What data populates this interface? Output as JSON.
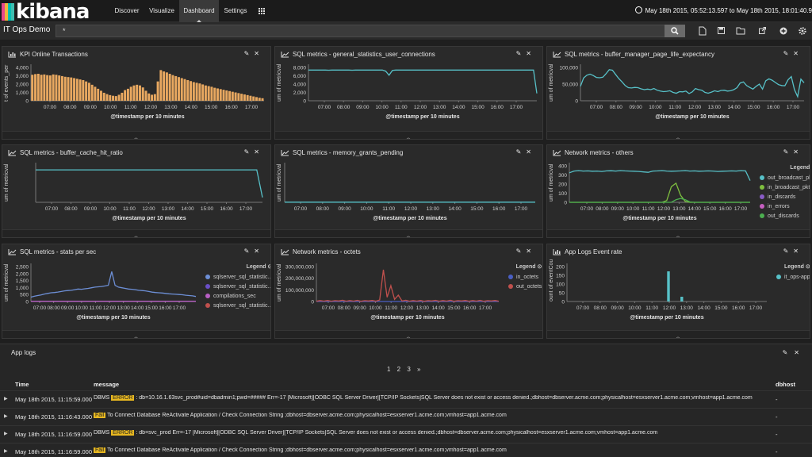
{
  "brand": {
    "logo_text": "kibana",
    "bar_colors": [
      "#e8478b",
      "#f0b73c",
      "#00bfb3",
      "#3ebeb0"
    ]
  },
  "nav": {
    "tabs": [
      "Discover",
      "Visualize",
      "Dashboard",
      "Settings"
    ],
    "active": "Dashboard",
    "more_icon": "apps-icon"
  },
  "timerange": {
    "text": "May 18th 2015, 05:52:13.597 to May 18th 2015, 18:01:40.9"
  },
  "dashboard": {
    "title": "IT Ops Demo",
    "query": "*"
  },
  "toolbar_icons": [
    "search-icon",
    "new-dashboard-icon",
    "save-icon",
    "open-icon",
    "share-icon",
    "add-panel-icon",
    "settings-icon"
  ],
  "panels": [
    {
      "id": "p1",
      "title": "KPI Online Transactions",
      "vis_icon": "bar-chart-icon",
      "ylabel": "t of events_per",
      "xlabel": "@timestamp per 10 minutes"
    },
    {
      "id": "p2",
      "title": "SQL metrics - general_statistics_user_connections",
      "vis_icon": "line-chart-icon",
      "ylabel": "um of metricval",
      "xlabel": "@timestamp per 10 minutes"
    },
    {
      "id": "p3",
      "title": "SQL metrics - buffer_manager_page_life_expectancy",
      "vis_icon": "line-chart-icon",
      "ylabel": "um of metricval",
      "xlabel": "@timestamp per 10 minutes"
    },
    {
      "id": "p4",
      "title": "SQL metrics - buffer_cache_hit_ratio",
      "vis_icon": "line-chart-icon",
      "ylabel": "um of metricval",
      "xlabel": "@timestamp per 10 minutes"
    },
    {
      "id": "p5",
      "title": "SQL metrics - memory_grants_pending",
      "vis_icon": "line-chart-icon",
      "ylabel": "um of metricval",
      "xlabel": "@timestamp per 10 minutes"
    },
    {
      "id": "p6",
      "title": "Network metrics - others",
      "vis_icon": "line-chart-icon",
      "ylabel": "um of metricval",
      "xlabel": "@timestamp per 10 minutes",
      "legend_title": "Legend",
      "legend": [
        {
          "label": "out_broadcast_pkts",
          "color": "#57c1c8"
        },
        {
          "label": "in_broadcast_pkts",
          "color": "#7fbf3f"
        },
        {
          "label": "in_discards",
          "color": "#8a5cc7"
        },
        {
          "label": "in_errors",
          "color": "#c55fc0"
        },
        {
          "label": "out_discards",
          "color": "#4caf50"
        }
      ]
    },
    {
      "id": "p7",
      "title": "SQL metrics - stats per sec",
      "vis_icon": "line-chart-icon",
      "ylabel": "um of metricval",
      "xlabel": "@timestamp per 10 minutes",
      "legend_title": "Legend",
      "legend": [
        {
          "label": "sqlserver_sql_statistic...",
          "color": "#6d8fd6"
        },
        {
          "label": "sqlserver_sql_statistic...",
          "color": "#6a4fc7"
        },
        {
          "label": "compilations_sec",
          "color": "#b85fc4"
        },
        {
          "label": "sqlserver_sql_statistic...",
          "color": "#c0504d"
        }
      ]
    },
    {
      "id": "p8",
      "title": "Network metrics - octets",
      "vis_icon": "line-chart-icon",
      "ylabel": "um of metricval",
      "xlabel": "@timestamp per 10 minutes",
      "legend_title": "Legend",
      "legend": [
        {
          "label": "in_octets",
          "color": "#4a5fc4"
        },
        {
          "label": "out_octets",
          "color": "#c0504d"
        }
      ]
    },
    {
      "id": "p9",
      "title": "App Logs Event rate",
      "vis_icon": "bar-chart-icon",
      "ylabel": "ount of eventCou",
      "xlabel": "@timestamp per 10 minutes",
      "legend_title": "Legend",
      "legend": [
        {
          "label": "it_ops-app",
          "color": "#57c1c8"
        }
      ]
    }
  ],
  "x_ticks": [
    "07:00",
    "08:00",
    "09:00",
    "10:00",
    "11:00",
    "12:00",
    "13:00",
    "14:00",
    "15:00",
    "16:00",
    "17:00"
  ],
  "p7_ticks": [
    "07:00",
    "08:00",
    "09:00",
    "10:00",
    "11:00",
    "12:00",
    "13:00",
    "14:00",
    "15:00",
    "16:00",
    "17:00"
  ],
  "chart_data": [
    {
      "panel": "p1",
      "type": "bar",
      "ylim": [
        0,
        5000
      ],
      "yticks": [
        "4,000",
        "3,000",
        "2,000",
        "1,000",
        "0"
      ],
      "color": "#e8a860",
      "values": [
        3900,
        4000,
        4050,
        3900,
        3950,
        3850,
        3800,
        3950,
        3900,
        3800,
        3700,
        3600,
        3550,
        3500,
        3400,
        3300,
        3200,
        3100,
        2900,
        2700,
        2400,
        2100,
        1800,
        1500,
        1200,
        1000,
        850,
        750,
        700,
        900,
        1200,
        1600,
        1800,
        2100,
        2300,
        2400,
        2300,
        2000,
        1500,
        1100,
        900,
        1000,
        2900,
        4600,
        4400,
        4250,
        4050,
        3850,
        3700,
        3550,
        3400,
        3250,
        3100,
        2950,
        2800,
        2700,
        2600,
        2450,
        2300,
        2200,
        2100,
        1950,
        1850,
        1750,
        1650,
        1550,
        1450,
        1350,
        1250,
        1150,
        1050,
        950,
        850,
        750,
        650,
        550,
        450,
        380
      ]
    },
    {
      "panel": "p2",
      "type": "line",
      "ylim": [
        0,
        9000
      ],
      "yticks": [
        "8,000",
        "6,000",
        "4,000",
        "2,000",
        "0"
      ],
      "color": "#57c1c8",
      "values": [
        8300,
        8300,
        8300,
        8300,
        8300,
        8300,
        8250,
        8300,
        8300,
        8300,
        8300,
        8300,
        8300,
        8250,
        8300,
        8300,
        8300,
        8300,
        8300,
        8300,
        8300,
        8300,
        8300,
        8000,
        6900,
        8200,
        8300,
        8300,
        8300,
        8300,
        8300,
        8300,
        8300,
        8300,
        8300,
        8300,
        8300,
        8300,
        8300,
        8300,
        8300,
        8300,
        8300,
        8300,
        8300,
        8300,
        8300,
        8300,
        8300,
        8300,
        8300,
        8300,
        8300,
        8300,
        8300,
        8300,
        8300,
        8300,
        8300,
        8300,
        8300,
        8300,
        8300,
        8300,
        8300,
        8300,
        8300,
        8300,
        2000
      ]
    },
    {
      "panel": "p3",
      "type": "line",
      "ylim": [
        0,
        120000
      ],
      "yticks": [
        "100,000",
        "50,000",
        "0"
      ],
      "color": "#57c1c8",
      "values": [
        52000,
        82000,
        92000,
        96000,
        91000,
        84000,
        83000,
        85000,
        97000,
        112000,
        110000,
        95000,
        80000,
        68000,
        55000,
        47000,
        46000,
        48000,
        47000,
        43000,
        40000,
        42000,
        40000,
        44000,
        38000,
        35000,
        33000,
        34000,
        36000,
        30000,
        27000,
        33000,
        32000,
        35000,
        26000,
        32000,
        44000,
        40000,
        38000,
        30000,
        27000,
        31000,
        36000,
        33000,
        37000,
        38000,
        35000,
        36000,
        40000,
        47000,
        64000,
        68000,
        55000,
        48000,
        42000,
        52000,
        60000,
        42000,
        72000,
        79000,
        74000,
        66000,
        58000,
        55000,
        54000,
        76000,
        87000,
        40000,
        15000,
        78000,
        65000
      ]
    },
    {
      "panel": "p4",
      "type": "line",
      "ylim": [
        0,
        450
      ],
      "yticks": [],
      "color": "#57c1c8",
      "values": [
        400,
        400,
        400,
        400,
        400,
        400,
        400,
        400,
        400,
        400,
        400,
        400,
        400,
        400,
        400,
        400,
        400,
        400,
        400,
        400,
        400,
        400,
        400,
        400,
        400,
        400,
        400,
        400,
        400,
        400,
        400,
        400,
        400,
        400,
        400,
        400,
        400,
        400,
        400,
        400,
        60
      ]
    },
    {
      "panel": "p5",
      "type": "line",
      "ylim": [
        0,
        450
      ],
      "yticks": [],
      "color": "#57c1c8",
      "values": [
        2,
        2,
        2,
        2,
        2,
        2,
        2,
        2,
        2,
        2,
        2,
        2,
        2,
        2,
        2,
        2,
        2,
        2,
        2,
        2,
        2,
        2,
        2,
        2,
        2,
        2,
        2,
        2,
        2,
        2,
        2,
        2,
        2,
        2,
        2,
        2,
        2,
        2,
        2,
        2
      ]
    },
    {
      "panel": "p6",
      "type": "line",
      "ylim": [
        0,
        420
      ],
      "yticks": [
        "400",
        "300",
        "200",
        "100",
        "0"
      ],
      "series": [
        {
          "name": "out_broadcast_pkts",
          "color": "#57c1c8",
          "values": [
            340,
            360,
            365,
            360,
            362,
            358,
            360,
            355,
            362,
            363,
            360,
            365,
            362,
            360,
            358,
            355,
            350,
            345,
            360,
            362,
            365,
            360,
            358,
            360,
            362,
            365,
            360,
            362,
            358,
            360,
            362,
            360,
            355,
            358,
            360,
            362,
            360,
            365,
            362,
            250
          ]
        },
        {
          "name": "in_broadcast_pkts",
          "color": "#7fbf3f",
          "values": [
            0,
            0,
            0,
            0,
            0,
            0,
            0,
            0,
            0,
            0,
            0,
            0,
            0,
            0,
            0,
            0,
            0,
            0,
            0,
            0,
            0,
            20,
            180,
            220,
            80,
            10,
            0,
            0,
            0,
            0,
            0,
            0,
            0,
            0,
            0,
            0,
            0,
            0,
            0,
            0
          ]
        },
        {
          "name": "out_discards",
          "color": "#4caf50",
          "values": [
            0,
            0,
            0,
            0,
            0,
            0,
            0,
            0,
            0,
            0,
            0,
            0,
            0,
            0,
            0,
            0,
            0,
            0,
            0,
            0,
            0,
            0,
            0,
            30,
            45,
            30,
            5,
            0,
            0,
            0,
            0,
            0,
            0,
            0,
            0,
            0,
            0,
            0,
            0,
            0
          ]
        }
      ]
    },
    {
      "panel": "p7",
      "type": "line",
      "ylim": [
        0,
        2800
      ],
      "yticks": [
        "2,500",
        "2,000",
        "1,500",
        "1,000",
        "500",
        "0"
      ],
      "series": [
        {
          "name": "sqlserver_sql_statistic...",
          "color": "#6d8fd6",
          "values": [
            350,
            420,
            480,
            520,
            600,
            650,
            700,
            720,
            760,
            800,
            850,
            880,
            900,
            950,
            1000,
            980,
            1020,
            1050,
            1100,
            1150,
            1180,
            1200,
            1250,
            1300,
            2400,
            1300,
            1150,
            1100,
            1050,
            1000,
            980,
            950,
            900,
            880,
            850,
            800,
            750,
            720,
            700,
            680,
            650,
            620,
            600,
            580,
            560,
            540,
            500,
            480,
            450,
            400
          ]
        },
        {
          "name": "compilations_sec",
          "color": "#b85fc4",
          "values": [
            20,
            20,
            20,
            20,
            20,
            20,
            20,
            20,
            20,
            20,
            20,
            20,
            20,
            20,
            20,
            20,
            20,
            20,
            20,
            20,
            20,
            20,
            20,
            20,
            20,
            20,
            20,
            20,
            20,
            20,
            20,
            20,
            20,
            20,
            20,
            20,
            20,
            20,
            20,
            20,
            20,
            20,
            20,
            20,
            20,
            20,
            20,
            20,
            20,
            20
          ]
        }
      ]
    },
    {
      "panel": "p8",
      "type": "line",
      "ylim": [
        0,
        330000000
      ],
      "yticks": [
        "300,000,000",
        "200,000,000",
        "100,000,000",
        "0"
      ],
      "series": [
        {
          "name": "in_octets",
          "color": "#4a5fc4",
          "values": [
            0,
            0,
            0,
            0,
            0,
            0,
            0,
            0,
            0,
            0,
            0,
            0,
            0,
            0,
            0,
            0,
            0,
            0,
            0,
            0,
            0,
            0,
            0,
            0,
            0,
            0,
            0,
            0,
            0,
            0,
            0,
            0,
            0,
            0,
            0,
            0,
            0,
            0,
            0,
            0,
            0,
            0,
            0,
            0,
            0,
            0,
            0,
            0,
            0,
            0
          ]
        },
        {
          "name": "out_octets",
          "color": "#c0504d",
          "values": [
            2000000,
            9000000,
            4000000,
            10000000,
            3000000,
            8000000,
            5000000,
            12000000,
            3000000,
            9000000,
            4000000,
            11000000,
            2000000,
            8000000,
            5000000,
            10000000,
            3000000,
            15000000,
            300000000,
            40000000,
            150000000,
            20000000,
            60000000,
            5000000,
            12000000,
            3000000,
            9000000,
            4000000,
            10000000,
            2000000,
            8000000,
            5000000,
            11000000,
            3000000,
            9000000,
            4000000,
            12000000,
            2000000,
            8000000,
            5000000,
            10000000,
            3000000,
            9000000,
            4000000,
            11000000,
            2000000,
            8000000,
            5000000,
            10000000,
            3000000
          ]
        }
      ]
    },
    {
      "panel": "p9",
      "type": "bar",
      "ylim": [
        0,
        220
      ],
      "yticks": [
        "200",
        "150",
        "100",
        "50",
        "0"
      ],
      "color": "#57c1c8",
      "values": [
        0,
        0,
        0,
        0,
        0,
        0,
        0,
        0,
        0,
        0,
        0,
        0,
        0,
        0,
        0,
        0,
        0,
        0,
        0,
        0,
        0,
        0,
        0,
        0,
        0,
        0,
        0,
        0,
        0,
        0,
        190,
        0,
        0,
        0,
        30,
        0,
        0,
        0,
        0,
        0,
        0,
        0,
        0,
        0,
        0,
        0,
        0,
        0,
        0,
        0,
        0,
        0,
        0,
        0,
        0,
        0,
        0,
        0,
        0,
        0
      ]
    }
  ],
  "logs": {
    "title": "App logs",
    "pages": "1  2  3  »",
    "columns": {
      "time": "Time",
      "message": "message",
      "dbhost": "dbhost"
    },
    "rows": [
      {
        "time": "May 18th 2015, 11:15:59.000",
        "pre": "DBMS ",
        "tag": "ERROR",
        "post": " : db=10.16.1.63svc_prod#uid=dbadmin1;pwd=##### Err=-17 [Microsoft][ODBC SQL Server Driver][TCP/IP Sockets]SQL Server does not exist or access denied.;dbhost=dbserver.acme.com;physicalhost=esxserver1.acme.com;vmhost=app1.acme.com",
        "dbhost": "-"
      },
      {
        "time": "May 18th 2015, 11:16:43.000",
        "pre": "",
        "tag": "Fail",
        "post": " To Connect Database   ReActivate Application / Check Connection String ;dbhost=dbserver.acme.com;physicalhost=esxserver1.acme.com;vmhost=app1.acme.com",
        "dbhost": "-"
      },
      {
        "time": "May 18th 2015, 11:16:59.000",
        "pre": "DBMS ",
        "tag": "ERROR",
        "post": " : db=svc_prod Err=-17 [Microsoft][ODBC SQL Server Driver][TCP/IP Sockets]SQL Server does not exist or access denied.;dbhost=dbserver.acme.com;physicalhost=esxserver1.acme.com;vmhost=app1.acme.com",
        "dbhost": "-"
      },
      {
        "time": "May 18th 2015, 11:16:59.000",
        "pre": "",
        "tag": "Fail",
        "post": " To Connect Database   ReActivate Application / Check Connection String ;dbhost=dbserver.acme.com;physicalhost=esxserver1.acme.com;vmhost=app1.acme.com",
        "dbhost": "-"
      }
    ]
  }
}
